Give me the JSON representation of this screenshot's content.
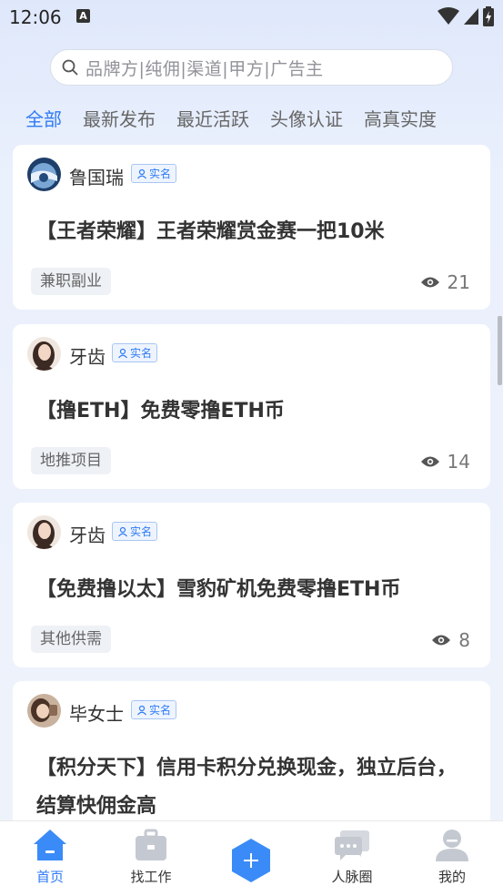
{
  "status": {
    "time": "12:06",
    "notify_letter": "A"
  },
  "search": {
    "placeholder": "品牌方|纯佣|渠道|甲方|广告主"
  },
  "tabs": [
    {
      "label": "全部"
    },
    {
      "label": "最新发布"
    },
    {
      "label": "最近活跃"
    },
    {
      "label": "头像认证"
    },
    {
      "label": "高真实度"
    }
  ],
  "posts": [
    {
      "author": "鲁国瑞",
      "badge": "实名",
      "title": "【王者荣耀】王者荣耀赏金赛一把10米",
      "tag": "兼职副业",
      "views": "21"
    },
    {
      "author": "牙齿",
      "badge": "实名",
      "title": "【撸ETH】免费零撸ETH币",
      "tag": "地推项目",
      "views": "14"
    },
    {
      "author": "牙齿",
      "badge": "实名",
      "title": "【免费撸以太】雪豹矿机免费零撸ETH币",
      "tag": "其他供需",
      "views": "8"
    },
    {
      "author": "毕女士",
      "badge": "实名",
      "title": "【积分天下】信用卡积分兑换现金，独立后台，结算快佣金高",
      "tag": "",
      "views": ""
    }
  ],
  "nav": [
    {
      "label": "首页",
      "icon": "home-icon"
    },
    {
      "label": "找工作",
      "icon": "briefcase-icon"
    },
    {
      "label": "",
      "icon": "plus-icon"
    },
    {
      "label": "人脉圈",
      "icon": "chat-icon"
    },
    {
      "label": "我的",
      "icon": "user-icon"
    }
  ],
  "colors": {
    "accent": "#2f7bf5",
    "background": "#eaf0fc"
  }
}
